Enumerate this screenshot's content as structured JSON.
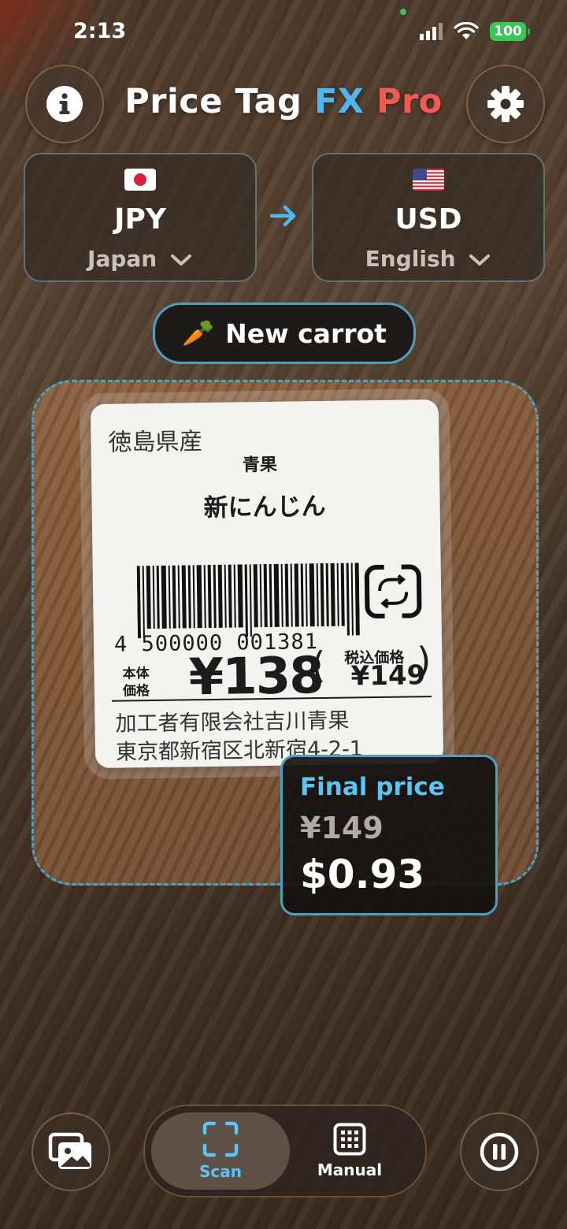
{
  "status_bar": {
    "time": "2:13",
    "battery": "100"
  },
  "header": {
    "title_part1": "Price Tag",
    "title_part2": "FX",
    "title_part3": "Pro",
    "info_icon": "info-icon",
    "settings_icon": "gear-icon"
  },
  "currencies": {
    "from": {
      "code": "JPY",
      "label": "Japan",
      "flag": "japan-flag-icon"
    },
    "to": {
      "code": "USD",
      "label": "English",
      "flag": "us-flag-icon"
    },
    "arrow_icon": "arrow-right-icon"
  },
  "product": {
    "emoji": "🥕",
    "name": "New carrot"
  },
  "price_tag": {
    "origin": "徳島県産",
    "category": "青果",
    "name": "新にんじん",
    "barcode_number": "4 500000 001381",
    "base_price_label": "本体 価格",
    "base_price": "¥138",
    "tax_label": "税込価格",
    "tax_price": "¥149",
    "company": "加工者有限会社吉川青果",
    "address": "東京都新宿区北新宿4-2-1"
  },
  "result": {
    "label": "Final price",
    "original": "¥149",
    "converted": "$0.93"
  },
  "bottom_bar": {
    "gallery_icon": "gallery-icon",
    "scan_label": "Scan",
    "manual_label": "Manual",
    "pause_icon": "pause-icon",
    "active_mode": "Scan"
  },
  "colors": {
    "accent_blue": "#4db8f0",
    "accent_red": "#f25b55",
    "border_blue": "#4e9ec0",
    "battery_green": "#35c759"
  }
}
